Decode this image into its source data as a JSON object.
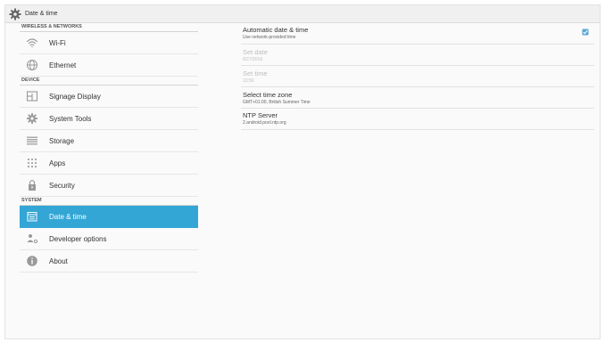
{
  "window": {
    "title": "Date & time"
  },
  "sidebar": {
    "sections": [
      {
        "header": "WIRELESS & NETWORKS",
        "items": [
          {
            "label": "Wi-Fi"
          },
          {
            "label": "Ethernet"
          }
        ]
      },
      {
        "header": "DEVICE",
        "items": [
          {
            "label": "Signage Display"
          },
          {
            "label": "System Tools"
          },
          {
            "label": "Storage"
          },
          {
            "label": "Apps"
          },
          {
            "label": "Security"
          }
        ]
      },
      {
        "header": "SYSTEM",
        "items": [
          {
            "label": "Date & time"
          },
          {
            "label": "Developer options"
          },
          {
            "label": "About"
          }
        ]
      }
    ],
    "selected": "Date & time",
    "accent_color": "#33a6d6"
  },
  "content": {
    "prefs": [
      {
        "title": "Automatic date & time",
        "summary": "Use network-provided time",
        "checked": true,
        "enabled": true
      },
      {
        "title": "Set date",
        "summary": "6/27/2016",
        "enabled": false
      },
      {
        "title": "Set time",
        "summary": "13:56",
        "enabled": false
      },
      {
        "title": "Select time zone",
        "summary": "GMT+01:00, British Summer Time",
        "enabled": true
      },
      {
        "title": "NTP Server",
        "summary": "2.android.pool.ntp.org",
        "enabled": true
      }
    ]
  },
  "icons": {
    "app": "gear-icon",
    "wifi": "wifi-icon",
    "ethernet": "globe-icon",
    "signage": "display-icon",
    "tools": "gear-icon",
    "storage": "storage-icon",
    "apps": "apps-grid-icon",
    "security": "lock-icon",
    "datetime": "calendar-icon",
    "developer": "developer-icon",
    "about": "info-icon",
    "checkbox": "checkbox-checked-icon"
  }
}
